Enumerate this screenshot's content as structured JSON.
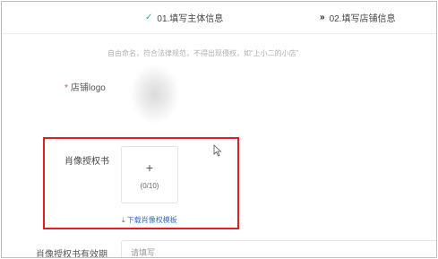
{
  "steps": [
    {
      "icon": "✓",
      "label": "01.填写主体信息"
    },
    {
      "icon": "»",
      "label": "02.填写店铺信息"
    }
  ],
  "store_name_hint": "自由命名，符合法律规范，不得出现侵权，如“上小二的小店”",
  "store_logo": {
    "required_mark": "*",
    "label": "店铺logo"
  },
  "portrait_authorization": {
    "label": "肖像授权书",
    "upload_icon": "+",
    "upload_count": "(0/10)",
    "download_link": "⤓ 下载肖像权模板"
  },
  "authorization_validity": {
    "label": "肖像授权书有效期",
    "placeholder": "请填写"
  },
  "colors": {
    "highlight_border": "#e02020",
    "link": "#2f6fd6",
    "step_done": "#2bb673",
    "required": "#e74c3c"
  }
}
